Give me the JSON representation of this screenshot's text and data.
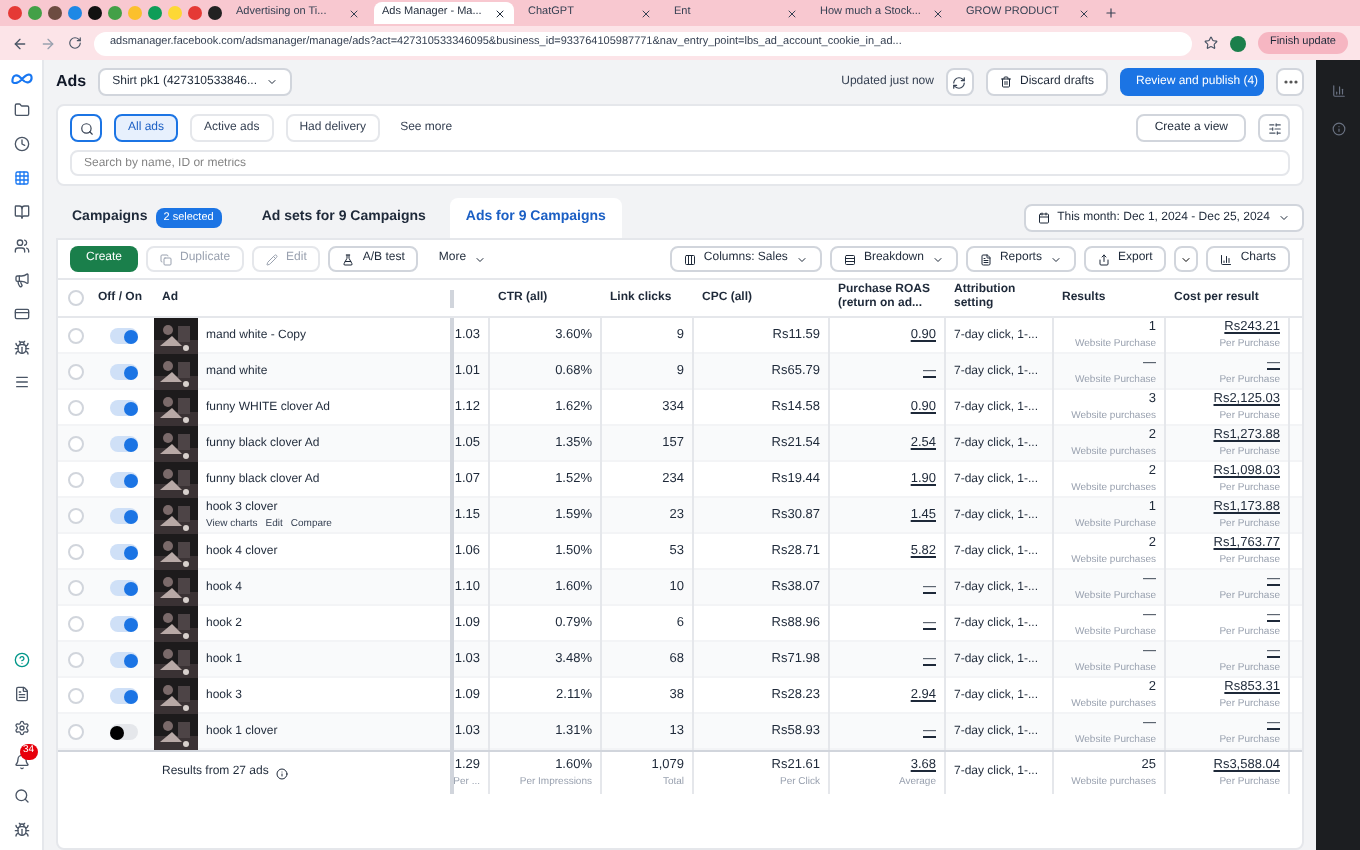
{
  "browser": {
    "pinned_tabs": [
      {
        "color": "#e53935"
      },
      {
        "color": "#43a047"
      },
      {
        "color": "#6d4c41"
      },
      {
        "color": "#1e88e5"
      },
      {
        "color": "#111111"
      },
      {
        "color": "#43a047"
      },
      {
        "color": "#fbc02d"
      },
      {
        "color": "#0f9d58"
      },
      {
        "color": "#fdd835"
      },
      {
        "color": "#e53935"
      },
      {
        "color": "#222222"
      }
    ],
    "tabs": [
      {
        "title": "Advertising on Ti...",
        "selected": false
      },
      {
        "title": "Ads Manager - Ma...",
        "selected": true
      },
      {
        "title": "ChatGPT",
        "selected": false
      },
      {
        "title": "Ent",
        "selected": false
      },
      {
        "title": "How much a Stock...",
        "selected": false
      },
      {
        "title": "GROW PRODUCT",
        "selected": false
      }
    ],
    "url": "adsmanager.facebook.com/adsmanager/manage/ads?act=427310533346095&business_id=933764105987771&nav_entry_point=lbs_ad_account_cookie_in_ad...",
    "finish_label": "Finish update"
  },
  "header": {
    "title": "Ads",
    "account": "Shirt pk1 (427310533846...",
    "status": "Updated just now",
    "discard": "Discard drafts",
    "publish": "Review and publish (4)"
  },
  "filters": [
    {
      "label": "All ads",
      "selected": true
    },
    {
      "label": "Active ads",
      "selected": false
    },
    {
      "label": "Had delivery",
      "selected": false
    }
  ],
  "see_more": "See more",
  "create_view": "Create a view",
  "search": {
    "placeholder": "Search by name, ID or metrics"
  },
  "levels": [
    {
      "label": "Campaigns",
      "badge": "2 selected",
      "selected": false
    },
    {
      "label": "Ad sets for 9 Campaigns",
      "selected": false
    },
    {
      "label": "Ads for 9 Campaigns",
      "selected": true
    }
  ],
  "date_range": "This month: Dec 1, 2024 - Dec 25, 2024",
  "toolbar": {
    "create": "Create",
    "duplicate": "Duplicate",
    "edit": "Edit",
    "ab_test": "A/B test",
    "more": "More",
    "columns": "Columns: Sales",
    "breakdown": "Breakdown",
    "reports": "Reports",
    "export": "Export",
    "charts": "Charts"
  },
  "table": {
    "select_all": {
      "checked": false
    },
    "columns": [
      "Off / On",
      "Ad",
      "CTR (all)",
      "Link clicks",
      "CPC (all)",
      "Purchase ROAS (return on ad...",
      "Attribution setting",
      "Results",
      "Cost per result"
    ],
    "rows": [
      {
        "on": true,
        "name": "mand white - Copy",
        "freq": "1.03",
        "ctr": "3.60%",
        "clicks": "9",
        "checked": false,
        "cpc": "Rs11.59",
        "roas": "0.90",
        "attr": "7-day click, 1-...",
        "results": "1",
        "results_sub": "Website Purchase",
        "cost": "Rs243.21",
        "cost_sub": "Per Purchase"
      },
      {
        "on": true,
        "name": "mand white",
        "freq": "1.01",
        "ctr": "0.68%",
        "clicks": "9",
        "checked": false,
        "cpc": "Rs65.79",
        "roas": "—",
        "attr": "7-day click, 1-...",
        "results": "—",
        "results_sub": "Website Purchase",
        "cost": "—",
        "cost_sub": "Per Purchase"
      },
      {
        "on": true,
        "name": "funny WHITE clover Ad",
        "freq": "1.12",
        "ctr": "1.62%",
        "clicks": "334",
        "checked": false,
        "cpc": "Rs14.58",
        "roas": "0.90",
        "attr": "7-day click, 1-...",
        "results": "3",
        "results_sub": "Website purchases",
        "cost": "Rs2,125.03",
        "cost_sub": "Per Purchase"
      },
      {
        "on": true,
        "name": "funny black clover Ad",
        "freq": "1.05",
        "ctr": "1.35%",
        "clicks": "157",
        "checked": false,
        "cpc": "Rs21.54",
        "roas": "2.54",
        "attr": "7-day click, 1-...",
        "results": "2",
        "results_sub": "Website purchases",
        "cost": "Rs1,273.88",
        "cost_sub": "Per Purchase"
      },
      {
        "on": true,
        "name": "funny black clover Ad",
        "freq": "1.07",
        "ctr": "1.52%",
        "clicks": "234",
        "checked": false,
        "cpc": "Rs19.44",
        "roas": "1.90",
        "attr": "7-day click, 1-...",
        "results": "2",
        "results_sub": "Website purchases",
        "cost": "Rs1,098.03",
        "cost_sub": "Per Purchase"
      },
      {
        "on": true,
        "name": "hook 3 clover",
        "freq": "1.15",
        "ctr": "1.59%",
        "clicks": "23",
        "checked": false,
        "cpc": "Rs30.87",
        "roas": "1.45",
        "attr": "7-day click, 1-...",
        "results": "1",
        "results_sub": "Website Purchase",
        "cost": "Rs1,173.88",
        "cost_sub": "Per Purchase",
        "actions": [
          "View charts",
          "Edit",
          "Compare"
        ]
      },
      {
        "on": true,
        "name": "hook 4 clover",
        "freq": "1.06",
        "ctr": "1.50%",
        "clicks": "53",
        "checked": false,
        "cpc": "Rs28.71",
        "roas": "5.82",
        "attr": "7-day click, 1-...",
        "results": "2",
        "results_sub": "Website purchases",
        "cost": "Rs1,763.77",
        "cost_sub": "Per Purchase"
      },
      {
        "on": true,
        "name": "hook 4",
        "freq": "1.10",
        "ctr": "1.60%",
        "clicks": "10",
        "checked": false,
        "cpc": "Rs38.07",
        "roas": "—",
        "attr": "7-day click, 1-...",
        "results": "—",
        "results_sub": "Website Purchase",
        "cost": "—",
        "cost_sub": "Per Purchase"
      },
      {
        "on": true,
        "name": "hook 2",
        "freq": "1.09",
        "ctr": "0.79%",
        "clicks": "6",
        "checked": false,
        "cpc": "Rs88.96",
        "roas": "—",
        "attr": "7-day click, 1-...",
        "results": "—",
        "results_sub": "Website Purchase",
        "cost": "—",
        "cost_sub": "Per Purchase"
      },
      {
        "on": true,
        "name": "hook 1",
        "freq": "1.03",
        "ctr": "3.48%",
        "clicks": "68",
        "checked": false,
        "cpc": "Rs71.98",
        "roas": "—",
        "attr": "7-day click, 1-...",
        "results": "—",
        "results_sub": "Website Purchase",
        "cost": "—",
        "cost_sub": "Per Purchase"
      },
      {
        "on": true,
        "name": "hook 3",
        "freq": "1.09",
        "ctr": "2.11%",
        "clicks": "38",
        "checked": false,
        "cpc": "Rs28.23",
        "roas": "2.94",
        "attr": "7-day click, 1-...",
        "results": "2",
        "results_sub": "Website purchases",
        "cost": "Rs853.31",
        "cost_sub": "Per Purchase"
      },
      {
        "on": false,
        "name": "hook 1 clover",
        "freq": "1.03",
        "ctr": "1.31%",
        "clicks": "13",
        "checked": false,
        "cpc": "Rs58.93",
        "roas": "—",
        "attr": "7-day click, 1-...",
        "results": "—",
        "results_sub": "Website Purchase",
        "cost": "—",
        "cost_sub": "Per Purchase"
      }
    ],
    "footer": {
      "label": "Results from 27 ads",
      "freq": "1.29",
      "freq_sub": "Per ...",
      "ctr": "1.60%",
      "ctr_sub": "Per Impressions",
      "clicks": "1,079",
      "clicks_sub": "Total",
      "cpc": "Rs21.61",
      "cpc_sub": "Per Click",
      "roas": "3.68",
      "roas_sub": "Average",
      "attr": "7-day click, 1-...",
      "results": "25",
      "results_sub": "Website purchases",
      "cost": "Rs3,588.04",
      "cost_sub": "Per Purchase"
    }
  },
  "notification_count": "34"
}
